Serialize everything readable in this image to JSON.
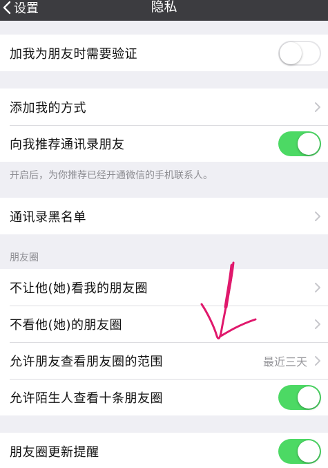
{
  "navbar": {
    "back_label": "设置",
    "title": "隐私"
  },
  "group1": {
    "verify_label": "加我为朋友时需要验证",
    "verify_on": false
  },
  "group2": {
    "add_method_label": "添加我的方式",
    "recommend_label": "向我推荐通讯录朋友",
    "recommend_on": true,
    "note": "开启后，为你推荐已经开通微信的手机联系人。"
  },
  "group3": {
    "blacklist_label": "通讯录黑名单"
  },
  "moments": {
    "header": "朋友圈",
    "hide_from_label": "不让他(她)看我的朋友圈",
    "dont_see_label": "不看他(她)的朋友圈",
    "range_label": "允许朋友查看朋友圈的范围",
    "range_value": "最近三天",
    "stranger_label": "允许陌生人查看十条朋友圈",
    "stranger_on": true
  },
  "group5": {
    "update_label": "朋友圈更新提醒",
    "update_on": true
  },
  "colors": {
    "toggle_on": "#4cd964",
    "navbar": "#3c3c40",
    "background": "#efeff4",
    "annotation": "#e0186c"
  }
}
